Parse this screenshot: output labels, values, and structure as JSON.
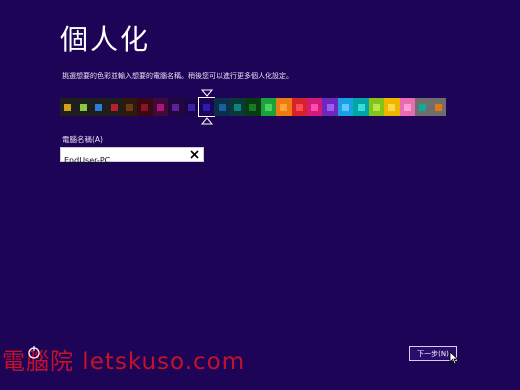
{
  "header": {
    "title": "個人化"
  },
  "instruction": "挑選想要的色彩並輸入想要的電腦名稱。稍後您可以進行更多個人化設定。",
  "color_picker": {
    "selected_index": 9,
    "swatches": [
      {
        "bg": "#1e1e1e",
        "chip": "#d4a017"
      },
      {
        "bg": "#1e1e1e",
        "chip": "#8ec63f"
      },
      {
        "bg": "#1e1e1e",
        "chip": "#2b7ed8"
      },
      {
        "bg": "#1e1e1e",
        "chip": "#b8202c"
      },
      {
        "bg": "#2d1a0a",
        "chip": "#6b3a16"
      },
      {
        "bg": "#3a0812",
        "chip": "#8a1426"
      },
      {
        "bg": "#3d0b3a",
        "chip": "#b2107b"
      },
      {
        "bg": "#22063c",
        "chip": "#5e1fa0"
      },
      {
        "bg": "#1a0548",
        "chip": "#3b1fa8"
      },
      {
        "bg": "#1e0456",
        "chip": "#2c19b8"
      },
      {
        "bg": "#0b2e4a",
        "chip": "#1a5fa0"
      },
      {
        "bg": "#083a3a",
        "chip": "#0f8181"
      },
      {
        "bg": "#0a3a12",
        "chip": "#167c2a"
      },
      {
        "bg": "#1aa33c",
        "chip": "#4bd160"
      },
      {
        "bg": "#ef7a10",
        "chip": "#ffa43a"
      },
      {
        "bg": "#d6222c",
        "chip": "#ff4a54"
      },
      {
        "bg": "#d41a78",
        "chip": "#ff4eaa"
      },
      {
        "bg": "#6f27c0",
        "chip": "#9c5cf0"
      },
      {
        "bg": "#1aa0e0",
        "chip": "#5cc8ff"
      },
      {
        "bg": "#00a6a6",
        "chip": "#3ed8d8"
      },
      {
        "bg": "#85c21a",
        "chip": "#b2e84a"
      },
      {
        "bg": "#efb600",
        "chip": "#ffd84a"
      },
      {
        "bg": "#e76cb0",
        "chip": "#ff9ed4"
      },
      {
        "bg": "#6e6e6e",
        "chip": "#12a89a"
      },
      {
        "bg": "#6e6e6e",
        "chip": "#e07818"
      }
    ]
  },
  "computer_name": {
    "label": "電腦名稱(A)",
    "value": "EndUser-PC"
  },
  "footer": {
    "next_label": "下一步(N)"
  },
  "watermark": {
    "text": "電腦院 letskuso.com",
    "color": "#c4122a"
  }
}
